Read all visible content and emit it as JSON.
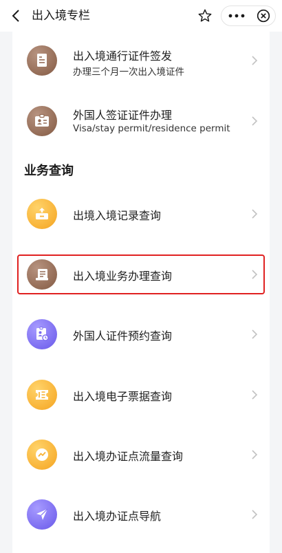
{
  "header": {
    "title": "出入境专栏",
    "back_icon": "chevron-left-icon",
    "favorite_icon": "star-icon",
    "more_icon": "more-dots-icon",
    "close_icon": "close-circle-icon"
  },
  "services": [
    {
      "title": "出入境通行证件签发",
      "subtitle": "办理三个月一次出入境证件",
      "icon": "document-icon",
      "color": "#936b55"
    },
    {
      "title": "外国人签证证件办理",
      "subtitle": "Visa/stay permit/residence permit",
      "icon": "id-card-icon",
      "color": "#936b55"
    }
  ],
  "query_section": {
    "title": "业务查询",
    "items": [
      {
        "title": "出境入境记录查询",
        "icon": "tray-upload-icon",
        "color": "#f8b236"
      },
      {
        "title": "出入境业务办理查询",
        "icon": "ticket-list-icon",
        "color": "#936b55",
        "highlighted": true
      },
      {
        "title": "外国人证件预约查询",
        "icon": "person-card-icon",
        "color": "#7b6cf0"
      },
      {
        "title": "出入境电子票据查询",
        "icon": "receipt-icon",
        "color": "#f8b236"
      },
      {
        "title": "出入境办证点流量查询",
        "icon": "trend-chart-icon",
        "color": "#f8b236"
      },
      {
        "title": "出入境办证点导航",
        "icon": "navigation-arrow-icon",
        "color": "#7b6cf0"
      }
    ]
  },
  "highlight_color": "#e02020"
}
